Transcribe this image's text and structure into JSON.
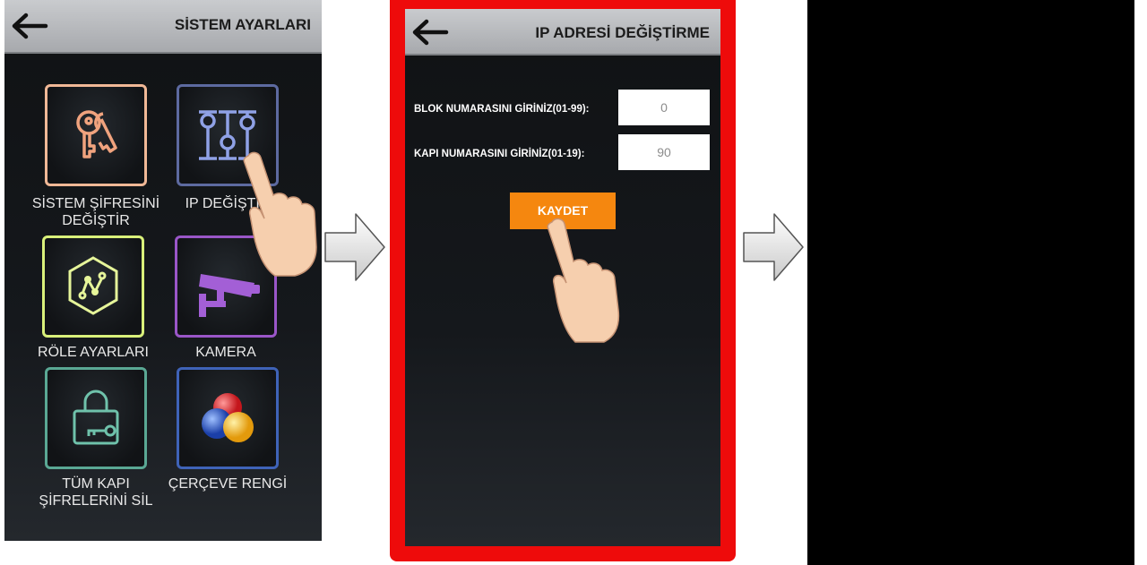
{
  "panel1": {
    "title": "SİSTEM AYARLARI",
    "tiles": [
      {
        "label": "SİSTEM ŞİFRESİNİ DEĞİŞTİR",
        "border": "#f0b896",
        "icon": "keys-icon"
      },
      {
        "label": "IP DEĞİŞTİR",
        "border": "#5d6aa0",
        "icon": "sliders-icon"
      },
      {
        "label": "RÖLE AYARLARI",
        "border": "#d9f07a",
        "icon": "relay-icon"
      },
      {
        "label": "KAMERA",
        "border": "#9a56c8",
        "icon": "camera-icon"
      },
      {
        "label": "TÜM KAPI ŞİFRELERİNİ SİL",
        "border": "#5aa894",
        "icon": "lock-key-icon"
      },
      {
        "label": "ÇERÇEVE RENGİ",
        "border": "#3f63b8",
        "icon": "color-balls-icon"
      }
    ]
  },
  "panel2": {
    "title": "IP ADRESİ DEĞİŞTİRME",
    "fields": [
      {
        "label": "BLOK NUMARASINI GİRİNİZ(01-99):",
        "value": "0"
      },
      {
        "label": "KAPI NUMARASINI GİRİNİZ(01-19):",
        "value": "90"
      }
    ],
    "save_label": "KAYDET",
    "frame_color": "#ee0b0b",
    "accent": "#f5870f"
  }
}
